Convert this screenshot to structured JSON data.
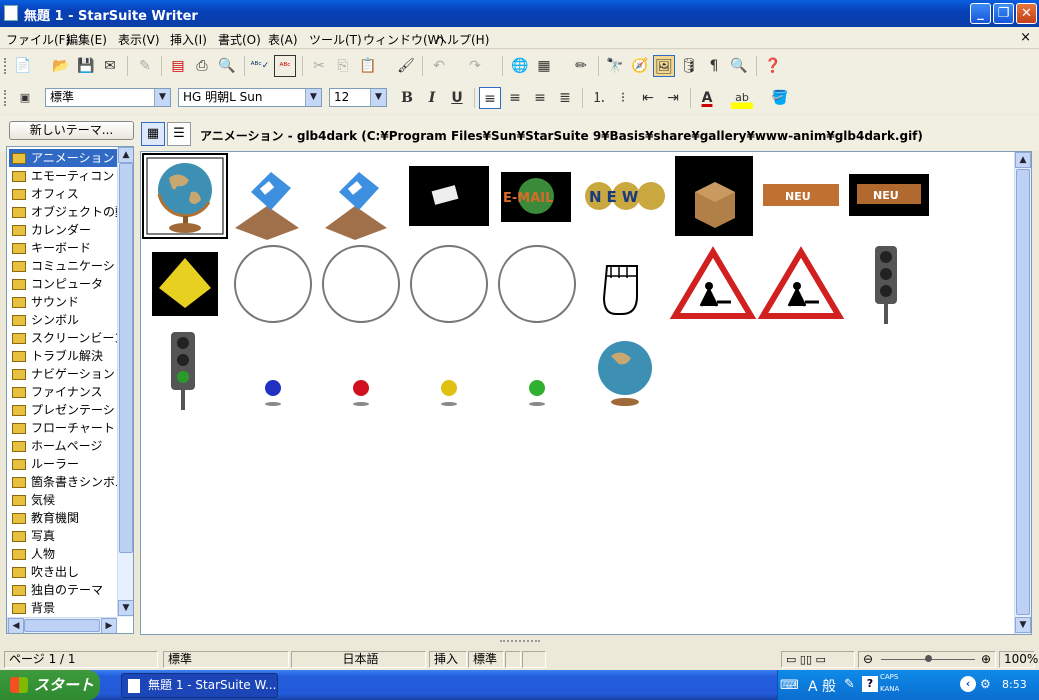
{
  "window": {
    "title": "無題 1 - StarSuite Writer"
  },
  "menu": {
    "items": [
      "ファイル(F)",
      "編集(E)",
      "表示(V)",
      "挿入(I)",
      "書式(O)",
      "表(A)",
      "ツール(T)",
      "ウィンドウ(W)",
      "ヘルプ(H)"
    ],
    "close": "×"
  },
  "format": {
    "style": "標準",
    "font": "HG 明朝L Sun",
    "size": "12",
    "bold": "B",
    "italic": "I",
    "underline": "U",
    "font_color_label": "A",
    "highlight_label": "ab"
  },
  "gallery": {
    "new_theme_button": "新しいテーマ...",
    "path": "アニメーション - glb4dark (C:¥Program Files¥Sun¥StarSuite 9¥Basis¥share¥gallery¥www-anim¥glb4dark.gif)",
    "themes": [
      "アニメーション",
      "エモーティコン",
      "オフィス",
      "オブジェクトの動作",
      "カレンダー",
      "キーボード",
      "コミュニケーション",
      "コンピュータ",
      "サウンド",
      "シンボル",
      "スクリーンビーンズ",
      "トラブル解決",
      "ナビゲーション",
      "ファイナンス",
      "プレゼンテーション",
      "フローチャート",
      "ホームページ",
      "ルーラー",
      "箇条書きシンボル",
      "気候",
      "教育機関",
      "写真",
      "人物",
      "吹き出し",
      "独自のテーマ",
      "背景"
    ],
    "selected_theme": "アニメーション",
    "items": [
      {
        "icon": "globe-icon",
        "label": "E-MAIL",
        "badge": "NEW",
        "sign": "NEU"
      }
    ],
    "item_texts": {
      "email": "E-MAIL",
      "new": "NEW",
      "neu": "NEU"
    }
  },
  "status": {
    "page": "ページ 1 / 1",
    "style": "標準",
    "language": "日本語",
    "mode": "挿入",
    "selection": "標準",
    "zoom": "100%"
  },
  "taskbar": {
    "start": "スタート",
    "task": "無題 1 - StarSuite W...",
    "tray_ime": "A 般",
    "tray_caps": "CAPS",
    "tray_kana": "KANA",
    "time": "8:53"
  },
  "colors": {
    "title_blue": "#0a50d8",
    "selection": "#316ac5",
    "start_green": "#3c9a3c"
  }
}
